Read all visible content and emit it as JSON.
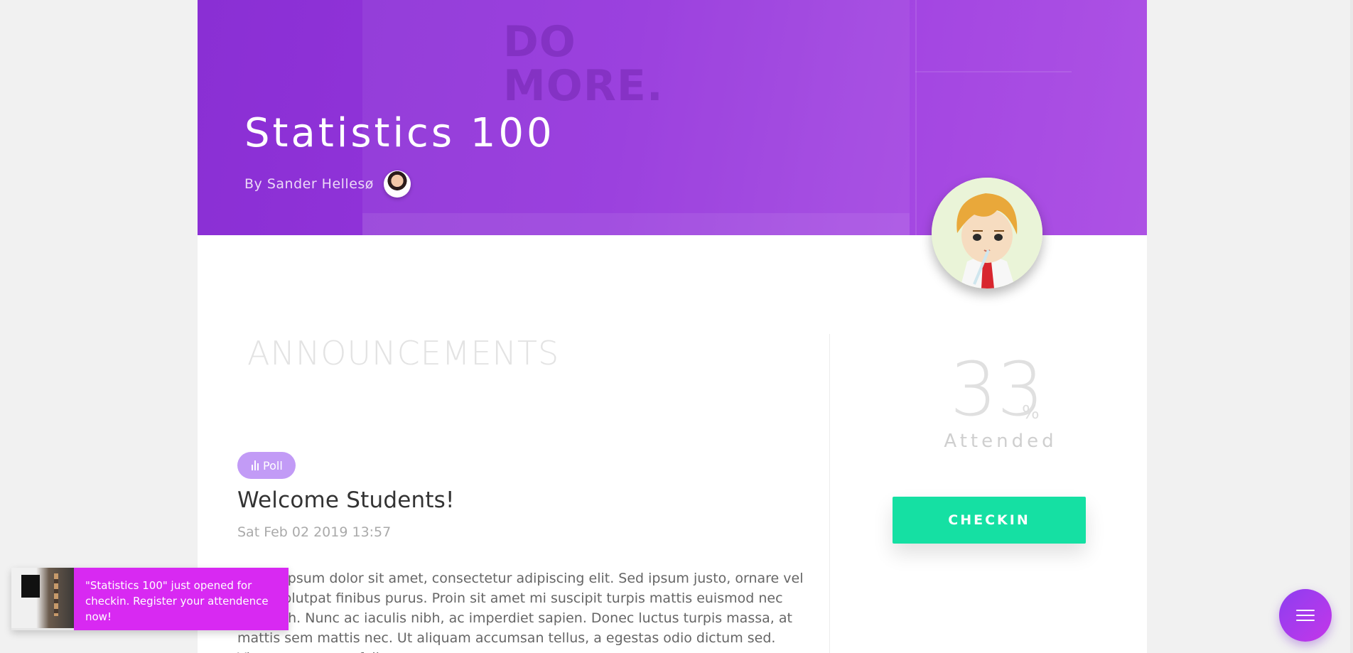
{
  "course": {
    "title": "Statistics 100",
    "byline": "By Sander Hellesø"
  },
  "section": {
    "heading": "ANNOUNCEMENTS"
  },
  "post": {
    "badge": "Poll",
    "title": "Welcome Students!",
    "date": "Sat Feb 02 2019 13:57",
    "body": "Lorem ipsum dolor sit amet, consectetur adipiscing elit. Sed ipsum justo, ornare vel diam volutpat finibus purus. Proin sit amet mi suscipit turpis mattis euismod nec non nibh. Nunc ac iaculis nibh, ac imperdiet sapien. Donec luctus turpis massa, at mattis sem mattis nec. Ut aliquam accumsan tellus, a egestas odio dictum sed. Vivamus semper, feli"
  },
  "attendance": {
    "value": "33",
    "unit": "%",
    "label": "Attended",
    "button": "CHECKIN"
  },
  "toast": {
    "message": "\"Statistics 100\" just opened for checkin. Register your attendence now!"
  },
  "hero_image": {
    "sign_text": "DO MORE."
  },
  "colors": {
    "hero": "#9536dc",
    "checkin": "#15e0a3",
    "badge": "#c29bf6",
    "toast": "#d829f2",
    "fab": "#a33bee"
  },
  "icons": {
    "badge": "poll-bars-icon",
    "fab": "menu-icon"
  }
}
